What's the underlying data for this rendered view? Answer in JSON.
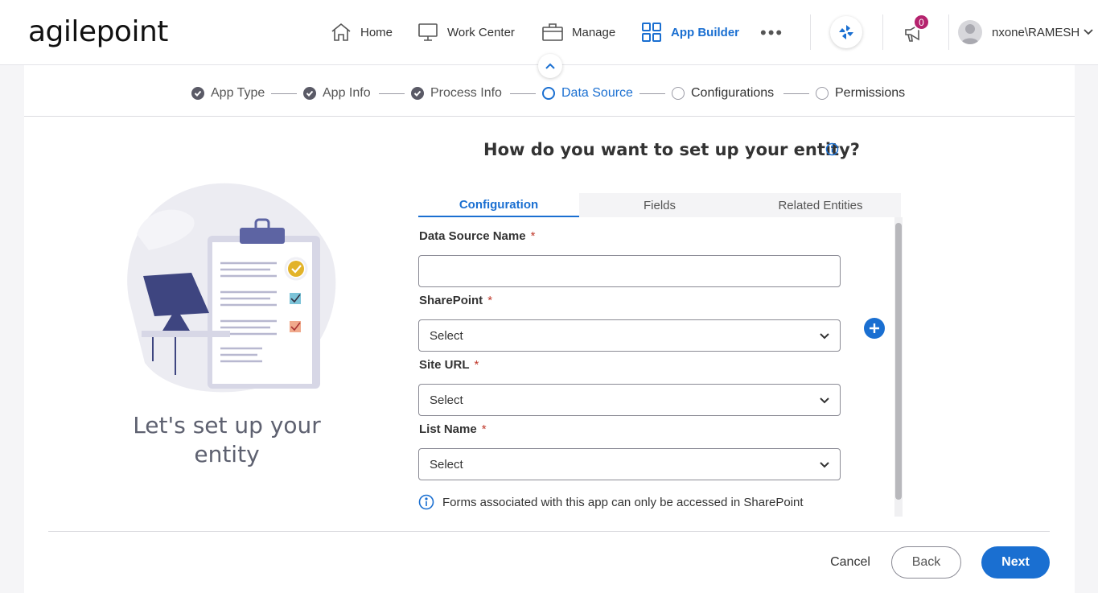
{
  "brand": {
    "logo_text": "agilepoint",
    "accent": "#1a6fd1"
  },
  "nav": {
    "home": "Home",
    "work_center": "Work Center",
    "manage": "Manage",
    "app_builder": "App Builder",
    "more": "•••",
    "notifications_count": "0",
    "user_name": "nxone\\RAMESH..."
  },
  "steps": [
    {
      "label": "App Type",
      "state": "done"
    },
    {
      "label": "App Info",
      "state": "done"
    },
    {
      "label": "Process Info",
      "state": "done"
    },
    {
      "label": "Data Source",
      "state": "current"
    },
    {
      "label": "Configurations",
      "state": "todo"
    },
    {
      "label": "Permissions",
      "state": "todo"
    }
  ],
  "heading": "How do you want to set up your entity?",
  "illustration_caption": "Let's set up your entity",
  "tabs": [
    {
      "label": "Configuration",
      "active": true
    },
    {
      "label": "Fields",
      "active": false
    },
    {
      "label": "Related Entities",
      "active": false
    }
  ],
  "form": {
    "data_source_name": {
      "label": "Data Source Name",
      "required": "*",
      "value": "",
      "placeholder": ""
    },
    "sharepoint": {
      "label": "SharePoint",
      "required": "*",
      "value": "Select"
    },
    "site_url": {
      "label": "Site URL",
      "required": "*",
      "value": "Select"
    },
    "list_name": {
      "label": "List Name",
      "required": "*",
      "value": "Select"
    },
    "notice": "Forms associated with this app can only be accessed in SharePoint"
  },
  "footer": {
    "cancel": "Cancel",
    "back": "Back",
    "next": "Next"
  }
}
